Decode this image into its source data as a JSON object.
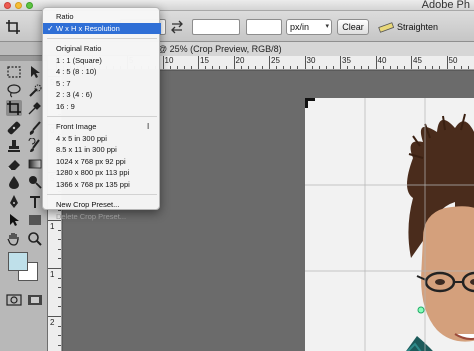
{
  "app": {
    "title": "Adobe Ph"
  },
  "options_bar": {
    "unit_select": "px/in",
    "clear_label": "Clear",
    "straighten_label": "Straighten"
  },
  "document": {
    "tab_title": "@ 25% (Crop Preview, RGB/8)"
  },
  "ruler": {
    "top_numbers": [
      "5",
      "0",
      "5",
      "10",
      "15",
      "20",
      "25",
      "30",
      "35",
      "40",
      "45",
      "50"
    ],
    "left_numbers": [
      "5",
      "0",
      "5",
      "1",
      "1",
      "2"
    ]
  },
  "crop_preset_menu": {
    "items": [
      {
        "label": "Ratio",
        "state": "normal"
      },
      {
        "label": "W x H x Resolution",
        "state": "selected",
        "check": "✓"
      },
      {
        "label": "",
        "state": "separator"
      },
      {
        "label": "Original Ratio",
        "state": "normal"
      },
      {
        "label": "1 : 1 (Square)",
        "state": "normal"
      },
      {
        "label": "4 : 5 (8 : 10)",
        "state": "normal"
      },
      {
        "label": "5 : 7",
        "state": "normal"
      },
      {
        "label": "2 : 3 (4 : 6)",
        "state": "normal"
      },
      {
        "label": "16 : 9",
        "state": "normal"
      },
      {
        "label": "",
        "state": "separator"
      },
      {
        "label": "Front Image",
        "state": "normal"
      },
      {
        "label": "4 x 5 in 300 ppi",
        "state": "normal"
      },
      {
        "label": "8.5 x 11 in 300 ppi",
        "state": "normal"
      },
      {
        "label": "1024 x 768 px 92 ppi",
        "state": "normal"
      },
      {
        "label": "1280 x 800 px 113 ppi",
        "state": "normal"
      },
      {
        "label": "1366 x 768 px 135 ppi",
        "state": "normal"
      },
      {
        "label": "",
        "state": "separator"
      },
      {
        "label": "New Crop Preset...",
        "state": "normal"
      },
      {
        "label": "Delete Crop Preset...",
        "state": "disabled"
      }
    ]
  },
  "colors": {
    "foreground": "#bfe0ea",
    "background": "#ffffff",
    "menu_highlight": "#2f6fd6"
  },
  "tools": [
    "marquee-icon",
    "lasso-icon",
    "crop-icon",
    "eyedropper-icon",
    "healing-icon",
    "brush-icon",
    "stamp-icon",
    "history-brush-icon",
    "eraser-icon",
    "gradient-icon",
    "blur-icon",
    "dodge-icon",
    "pen-icon",
    "type-icon",
    "path-select-icon",
    "shape-icon",
    "hand-icon",
    "zoom-icon",
    "quick-mask-icon",
    "screen-mode-icon"
  ]
}
